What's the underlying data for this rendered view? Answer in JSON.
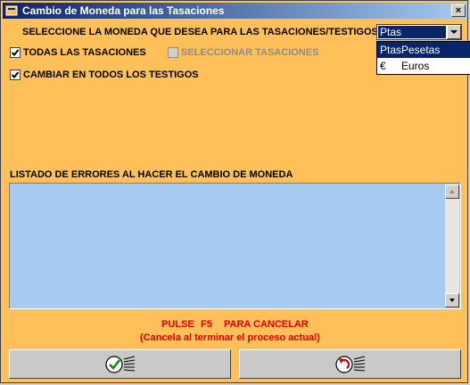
{
  "window": {
    "title": "Cambio de Moneda para las Tasaciones"
  },
  "currency": {
    "prompt": "SELECCIONE LA MONEDA QUE DESEA PARA LAS TASACIONES/TESTIGOS",
    "selected": "Ptas",
    "options": [
      {
        "code": "Ptas",
        "name": "Pesetas"
      },
      {
        "code": "€",
        "name": "Euros"
      }
    ]
  },
  "options": {
    "all_appraisals": "TODAS LAS TASACIONES",
    "select_appraisals": "SELECCIONAR TASACIONES",
    "change_all_witnesses": "CAMBIAR EN TODOS LOS TESTIGOS"
  },
  "errors": {
    "heading": "LISTADO DE ERRORES AL HACER EL CAMBIO DE MONEDA"
  },
  "cancel_hint": {
    "press": "PULSE",
    "key": "F5",
    "action": "PARA CANCELAR",
    "note": "(Cancela al terminar el proceso actual)"
  },
  "colors": {
    "background": "#ffbf59",
    "error_list": "#a6caf0",
    "title_bar": "#0a246a",
    "hint": "#e00000"
  },
  "icons": {
    "accept": "check-icon",
    "cancel": "undo-icon"
  }
}
